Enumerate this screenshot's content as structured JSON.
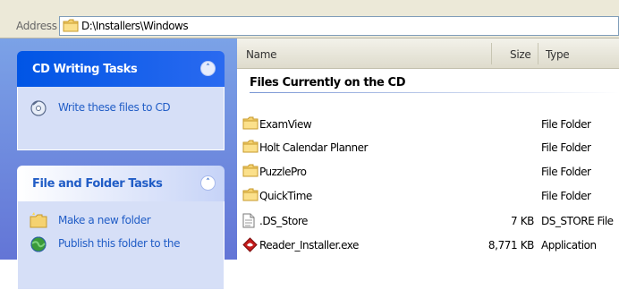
{
  "address": {
    "label": "Address",
    "path": "D:\\Installers\\Windows"
  },
  "tasks": {
    "cd_writing": {
      "title": "CD Writing Tasks",
      "items": [
        {
          "label": "Write these files to CD",
          "icon": "cd-write-icon"
        }
      ]
    },
    "file_folder": {
      "title": "File and Folder Tasks",
      "items": [
        {
          "label": "Make a new folder",
          "icon": "new-folder-icon"
        },
        {
          "label": "Publish this folder to the",
          "icon": "globe-publish-icon"
        }
      ]
    }
  },
  "file_list": {
    "columns": {
      "name": "Name",
      "size": "Size",
      "type": "Type"
    },
    "group_heading": "Files Currently on the CD",
    "rows": [
      {
        "name": "ExamView",
        "size": "",
        "type": "File Folder",
        "icon": "folder-icon"
      },
      {
        "name": "Holt Calendar Planner",
        "size": "",
        "type": "File Folder",
        "icon": "folder-icon"
      },
      {
        "name": "PuzzlePro",
        "size": "",
        "type": "File Folder",
        "icon": "folder-icon"
      },
      {
        "name": "QuickTime",
        "size": "",
        "type": "File Folder",
        "icon": "folder-icon"
      },
      {
        "name": ".DS_Store",
        "size": "7 KB",
        "type": "DS_STORE File",
        "icon": "file-icon"
      },
      {
        "name": "Reader_Installer.exe",
        "size": "8,771 KB",
        "type": "Application",
        "icon": "installer-icon"
      }
    ]
  },
  "colors": {
    "task_pane_bg": "#7ba2e7",
    "task_header_blue": "#0055e5",
    "task_link": "#215dc6",
    "folder_yellow": "#f5d271"
  }
}
